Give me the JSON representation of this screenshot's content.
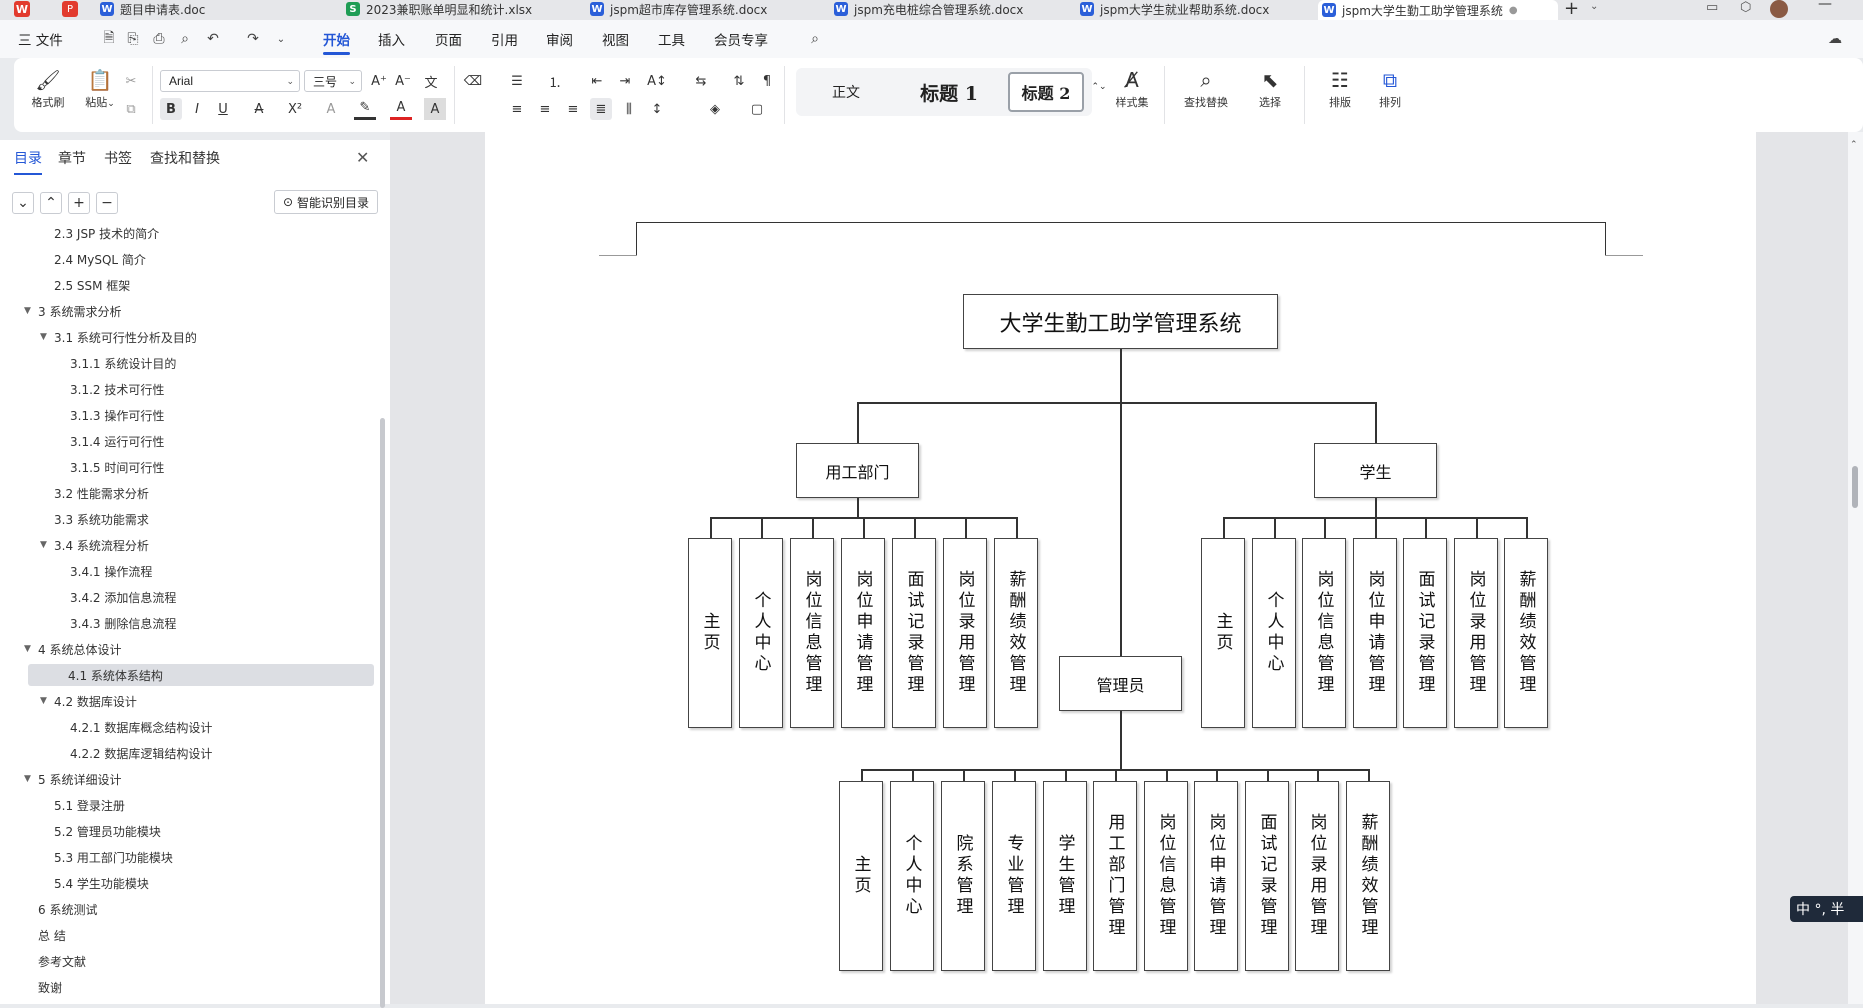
{
  "tabs": [
    {
      "label": "题目申请表.doc",
      "type": "W",
      "color": "#2b5fd9"
    },
    {
      "label": "2023兼职账单明显和统计.xlsx",
      "type": "S",
      "color": "#1f9d55"
    },
    {
      "label": "jspm超市库存管理系统.docx",
      "type": "W",
      "color": "#2b5fd9"
    },
    {
      "label": "jspm充电桩综合管理系统.docx",
      "type": "W",
      "color": "#2b5fd9"
    },
    {
      "label": "jspm大学生就业帮助系统.docx",
      "type": "W",
      "color": "#2b5fd9"
    },
    {
      "label": "jspm大学生勤工助学管理系统",
      "type": "W",
      "color": "#2b5fd9"
    }
  ],
  "menu": {
    "file": "三 文件",
    "items": [
      "开始",
      "插入",
      "页面",
      "引用",
      "审阅",
      "视图",
      "工具",
      "会员专享"
    ],
    "active": "开始"
  },
  "ribbon": {
    "format_painter": "格式刷",
    "paste": "粘贴",
    "font_name": "Arial",
    "font_size": "三号",
    "styles": [
      "正文",
      "标题 1",
      "标题 2"
    ],
    "styleset": "样式集",
    "find_replace": "查找替换",
    "select": "选择",
    "layout": "排版",
    "arrange": "排列"
  },
  "nav": {
    "tabs": [
      "目录",
      "章节",
      "书签",
      "查找和替换"
    ],
    "active_tab": "目录",
    "smart_toc": "智能识别目录",
    "items": [
      {
        "label": "2.3 JSP 技术的简介",
        "level": 2,
        "tri": ""
      },
      {
        "label": "2.4 MySQL 简介",
        "level": 2,
        "tri": ""
      },
      {
        "label": "2.5 SSM 框架",
        "level": 2,
        "tri": ""
      },
      {
        "label": "3  系统需求分析",
        "level": 1,
        "tri": "▼"
      },
      {
        "label": "3.1  系统可行性分析及目的",
        "level": 2,
        "tri": "▼"
      },
      {
        "label": "3.1.1  系统设计目的",
        "level": 3,
        "tri": ""
      },
      {
        "label": "3.1.2  技术可行性",
        "level": 3,
        "tri": ""
      },
      {
        "label": "3.1.3  操作可行性",
        "level": 3,
        "tri": ""
      },
      {
        "label": "3.1.4  运行可行性",
        "level": 3,
        "tri": ""
      },
      {
        "label": "3.1.5  时间可行性",
        "level": 3,
        "tri": ""
      },
      {
        "label": "3.2  性能需求分析",
        "level": 2,
        "tri": ""
      },
      {
        "label": "3.3 系统功能需求",
        "level": 2,
        "tri": ""
      },
      {
        "label": "3.4 系统流程分析",
        "level": 2,
        "tri": "▼"
      },
      {
        "label": "3.4.1 操作流程",
        "level": 3,
        "tri": ""
      },
      {
        "label": "3.4.2 添加信息流程",
        "level": 3,
        "tri": ""
      },
      {
        "label": "3.4.3 删除信息流程",
        "level": 3,
        "tri": ""
      },
      {
        "label": "4   系统总体设计",
        "level": 1,
        "tri": "▼"
      },
      {
        "label": "4.1  系统体系结构",
        "level": 2,
        "tri": "",
        "selected": true
      },
      {
        "label": "4.2  数据库设计",
        "level": 2,
        "tri": "▼"
      },
      {
        "label": "4.2.1  数据库概念结构设计",
        "level": 3,
        "tri": ""
      },
      {
        "label": "4.2.2 数据库逻辑结构设计",
        "level": 3,
        "tri": ""
      },
      {
        "label": "5  系统详细设计",
        "level": 1,
        "tri": "▼"
      },
      {
        "label": "5.1 登录注册",
        "level": 2,
        "tri": ""
      },
      {
        "label": "5.2 管理员功能模块",
        "level": 2,
        "tri": ""
      },
      {
        "label": "5.3 用工部门功能模块",
        "level": 2,
        "tri": ""
      },
      {
        "label": "5.4 学生功能模块",
        "level": 2,
        "tri": ""
      },
      {
        "label": "6  系统测试",
        "level": 1,
        "tri": ""
      },
      {
        "label": "总 结",
        "level": 1,
        "tri": ""
      },
      {
        "label": "参考文献",
        "level": 1,
        "tri": ""
      },
      {
        "label": "致谢",
        "level": 1,
        "tri": ""
      }
    ]
  },
  "diagram": {
    "root": "大学生勤工助学管理系统",
    "branches": {
      "dept": {
        "title": "用工部门",
        "children": [
          "主页",
          "个人中心",
          "岗位信息管理",
          "岗位申请管理",
          "面试记录管理",
          "岗位录用管理",
          "薪酬绩效管理"
        ]
      },
      "student": {
        "title": "学生",
        "children": [
          "主页",
          "个人中心",
          "岗位信息管理",
          "岗位申请管理",
          "面试记录管理",
          "岗位录用管理",
          "薪酬绩效管理"
        ]
      },
      "admin": {
        "title": "管理员",
        "children": [
          "主页",
          "个人中心",
          "院系管理",
          "专业管理",
          "学生管理",
          "用工部门管理",
          "岗位信息管理",
          "岗位申请管理",
          "面试记录管理",
          "岗位录用管理",
          "薪酬绩效管理"
        ]
      }
    }
  },
  "ime": {
    "label": "中 °, 半"
  }
}
